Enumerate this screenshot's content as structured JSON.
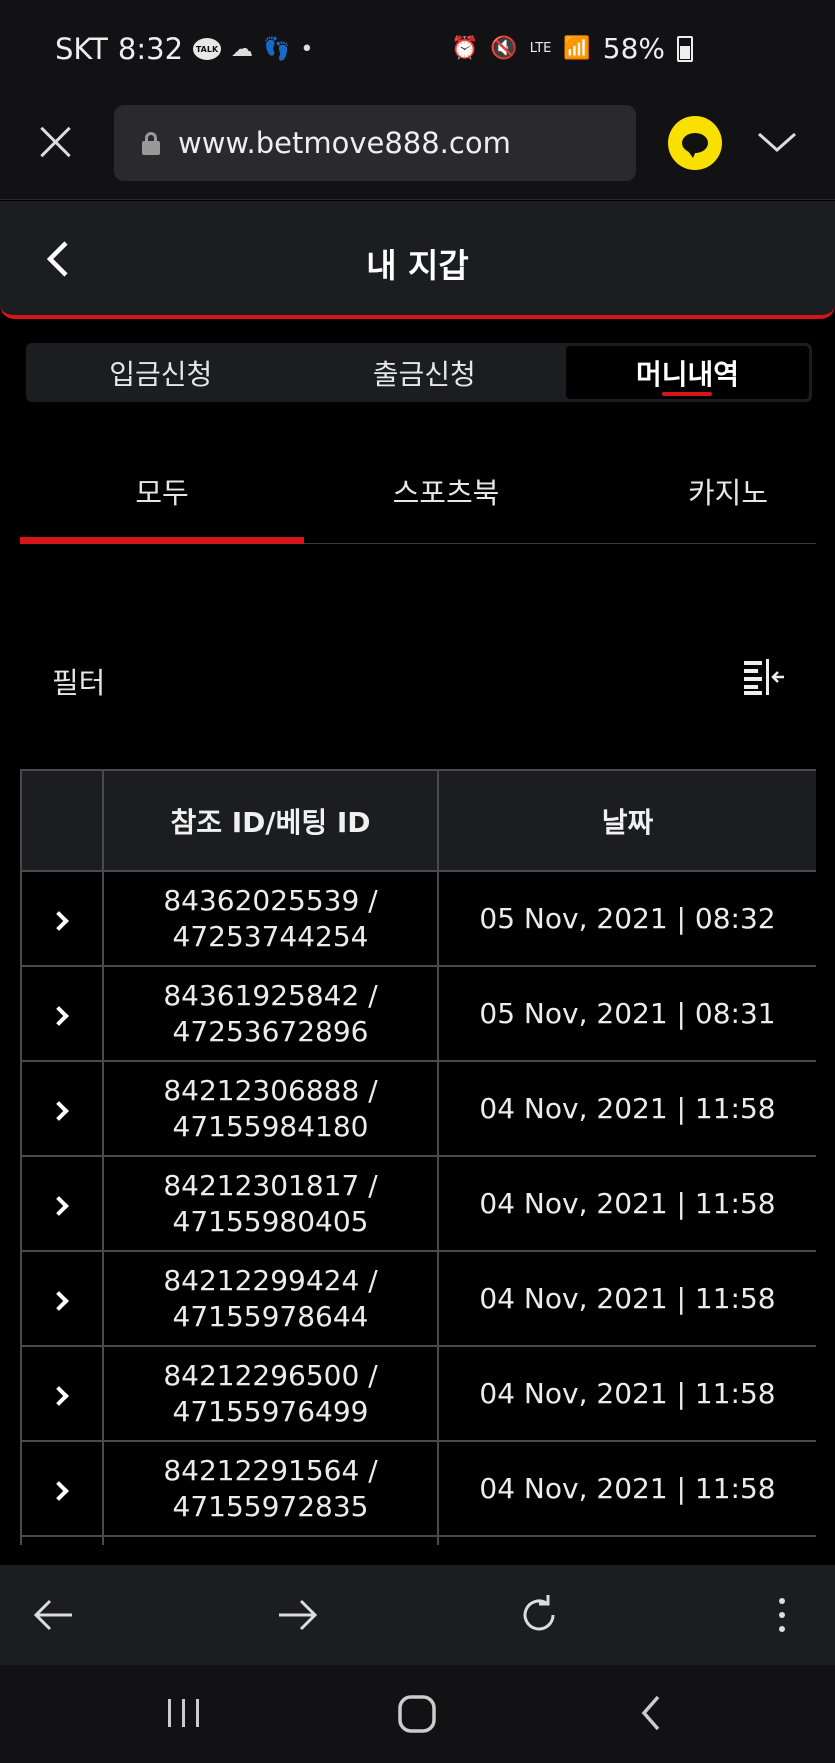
{
  "status_bar": {
    "carrier": "SKT",
    "time": "8:32",
    "talk_badge": "TALK",
    "network": "LTE",
    "battery": "58%"
  },
  "browser": {
    "url": "www.betmove888.com"
  },
  "header": {
    "title": "내 지갑"
  },
  "segment_tabs": [
    {
      "label": "입금신청",
      "active": false
    },
    {
      "label": "출금신청",
      "active": false
    },
    {
      "label": "머니내역",
      "active": true
    }
  ],
  "category_tabs": [
    {
      "label": "모두",
      "active": true
    },
    {
      "label": "스포츠북",
      "active": false
    },
    {
      "label": "카지노",
      "active": false
    }
  ],
  "filter": {
    "label": "필터"
  },
  "table": {
    "headers": [
      "",
      "참조 ID/베팅 ID",
      "날짜"
    ],
    "rows": [
      {
        "ref_id": "84362025539 /",
        "bet_id": "47253744254",
        "date": "05 Nov, 2021 | 08:32"
      },
      {
        "ref_id": "84361925842 /",
        "bet_id": "47253672896",
        "date": "05 Nov, 2021 | 08:31"
      },
      {
        "ref_id": "84212306888 /",
        "bet_id": "47155984180",
        "date": "04 Nov, 2021 | 11:58"
      },
      {
        "ref_id": "84212301817 /",
        "bet_id": "47155980405",
        "date": "04 Nov, 2021 | 11:58"
      },
      {
        "ref_id": "84212299424 /",
        "bet_id": "47155978644",
        "date": "04 Nov, 2021 | 11:58"
      },
      {
        "ref_id": "84212296500 /",
        "bet_id": "47155976499",
        "date": "04 Nov, 2021 | 11:58"
      },
      {
        "ref_id": "84212291564 /",
        "bet_id": "47155972835",
        "date": "04 Nov, 2021 | 11:58"
      }
    ]
  },
  "colors": {
    "accent": "#d6151b",
    "kakao": "#f9e000",
    "panel": "#1c1d21"
  }
}
